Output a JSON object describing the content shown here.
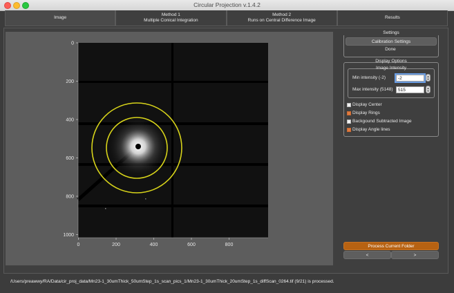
{
  "window": {
    "title": "Circular Projection v.1.4.2"
  },
  "tabs": [
    {
      "line1": "Image",
      "line2": ""
    },
    {
      "line1": "Method 1",
      "line2": "Multiple Conical Integration"
    },
    {
      "line1": "Method 2",
      "line2": "Runs on Central Difference Image"
    },
    {
      "line1": "Results",
      "line2": ""
    }
  ],
  "plot": {
    "x_ticks": [
      "0",
      "200",
      "400",
      "600",
      "800"
    ],
    "y_ticks": [
      "0",
      "200",
      "400",
      "600",
      "800",
      "1000"
    ],
    "ring_color": "#d8d41a"
  },
  "settings": {
    "title": "Settings",
    "calibration_button": "Calibration Settings",
    "done_button": "Done"
  },
  "display_options": {
    "title": "Display Options",
    "intensity_title": "Image Intensity",
    "min_label": "Min intensity (-2)",
    "min_value": "-2",
    "max_label": "Max intensity (5148)",
    "max_value": "515",
    "checkboxes": [
      {
        "label": "Display Center",
        "checked": false
      },
      {
        "label": "Display Rings",
        "checked": true
      },
      {
        "label": "Backgound Subtracted Image",
        "checked": false
      },
      {
        "label": "Display Angle lines",
        "checked": true
      }
    ]
  },
  "actions": {
    "process_folder": "Process Current Folder",
    "prev": "<",
    "next": ">"
  },
  "status": "/Users/preawwy/RA/Data/cir_proj_data/Mn23-1_30umThick_50umStep_1s_scan_pics_1/Mn23-1_30umThick_20umStep_1s_diffScan_0264.tif (9/21) is processed."
}
